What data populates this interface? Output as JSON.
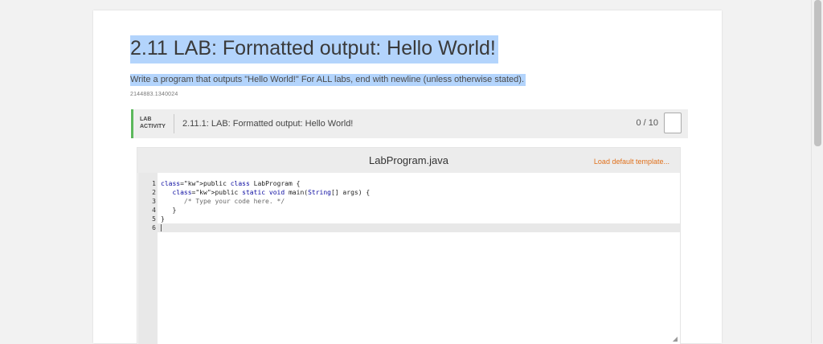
{
  "lab": {
    "title": "2.11 LAB: Formatted output: Hello World!",
    "description": "Write a program that outputs \"Hello World!\" For ALL labs, end with newline (unless otherwise stated).",
    "code_id": "2144883.1340024"
  },
  "activity": {
    "tag_line1": "LAB",
    "tag_line2": "ACTIVITY",
    "title": "2.11.1: LAB: Formatted output: Hello World!",
    "score": "0 / 10",
    "accent_color": "#5cb85c"
  },
  "editor": {
    "filename": "LabProgram.java",
    "load_template_label": "Load default template...",
    "load_template_color": "#e0701b",
    "lines": [
      {
        "n": "1",
        "text": "public class LabProgram {"
      },
      {
        "n": "2",
        "text": "   public static void main(String[] args) {"
      },
      {
        "n": "3",
        "text": "      /* Type your code here. */"
      },
      {
        "n": "4",
        "text": "   }"
      },
      {
        "n": "5",
        "text": "}"
      },
      {
        "n": "6",
        "text": ""
      }
    ]
  },
  "icons": {
    "score_box": "score-box-icon",
    "resize": "resize-handle-icon"
  }
}
